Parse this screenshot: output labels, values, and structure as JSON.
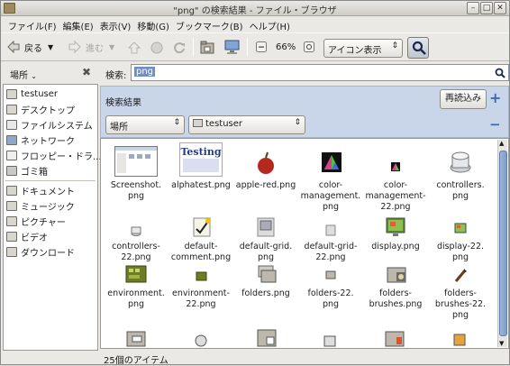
{
  "window": {
    "title": "\"png\" の検索結果 - ファイル・ブラウザ"
  },
  "menu": [
    "ファイル(F)",
    "編集(E)",
    "表示(V)",
    "移動(G)",
    "ブックマーク(B)",
    "ヘルプ(H)"
  ],
  "toolbar": {
    "back": "戻る",
    "forward": "進む",
    "zoom": "66%",
    "view_mode": "アイコン表示"
  },
  "places": {
    "label": "場所"
  },
  "search": {
    "label": "検索:",
    "query": "png"
  },
  "results": {
    "title": "検索結果",
    "reload": "再読込み",
    "location": "場所",
    "folder": "testuser"
  },
  "sidebar": {
    "group1": [
      "testuser",
      "デスクトップ",
      "ファイルシステム",
      "ネットワーク",
      "フロッピー・ドラ...",
      "ゴミ箱"
    ],
    "group2": [
      "ドキュメント",
      "ミュージック",
      "ピクチャー",
      "ビデオ",
      "ダウンロード"
    ]
  },
  "files": [
    {
      "name": "Screenshot.\npng",
      "icon": "screenshot"
    },
    {
      "name": "alphatest.png",
      "icon": "testing"
    },
    {
      "name": "apple-red.png",
      "icon": "apple"
    },
    {
      "name": "color-\nmanagement.\npng",
      "icon": "color"
    },
    {
      "name": "color-\nmanagement-\n22.png",
      "icon": "color-small"
    },
    {
      "name": "controllers.\npng",
      "icon": "controllers"
    },
    {
      "name": "controllers-\n22.png",
      "icon": "controllers-small"
    },
    {
      "name": "default-\ncomment.png",
      "icon": "comment"
    },
    {
      "name": "default-grid.\npng",
      "icon": "grid"
    },
    {
      "name": "default-grid-\n22.png",
      "icon": "grid-small"
    },
    {
      "name": "display.png",
      "icon": "display"
    },
    {
      "name": "display-22.\npng",
      "icon": "display-small"
    },
    {
      "name": "environment.\npng",
      "icon": "environment"
    },
    {
      "name": "environment-\n22.png",
      "icon": "environment-small"
    },
    {
      "name": "folders.png",
      "icon": "folders"
    },
    {
      "name": "folders-22.\npng",
      "icon": "folders-small"
    },
    {
      "name": "folders-\nbrushes.png",
      "icon": "brushes"
    },
    {
      "name": "folders-\nbrushes-22.\npng",
      "icon": "brushes-small"
    }
  ],
  "status": "25個のアイテム"
}
